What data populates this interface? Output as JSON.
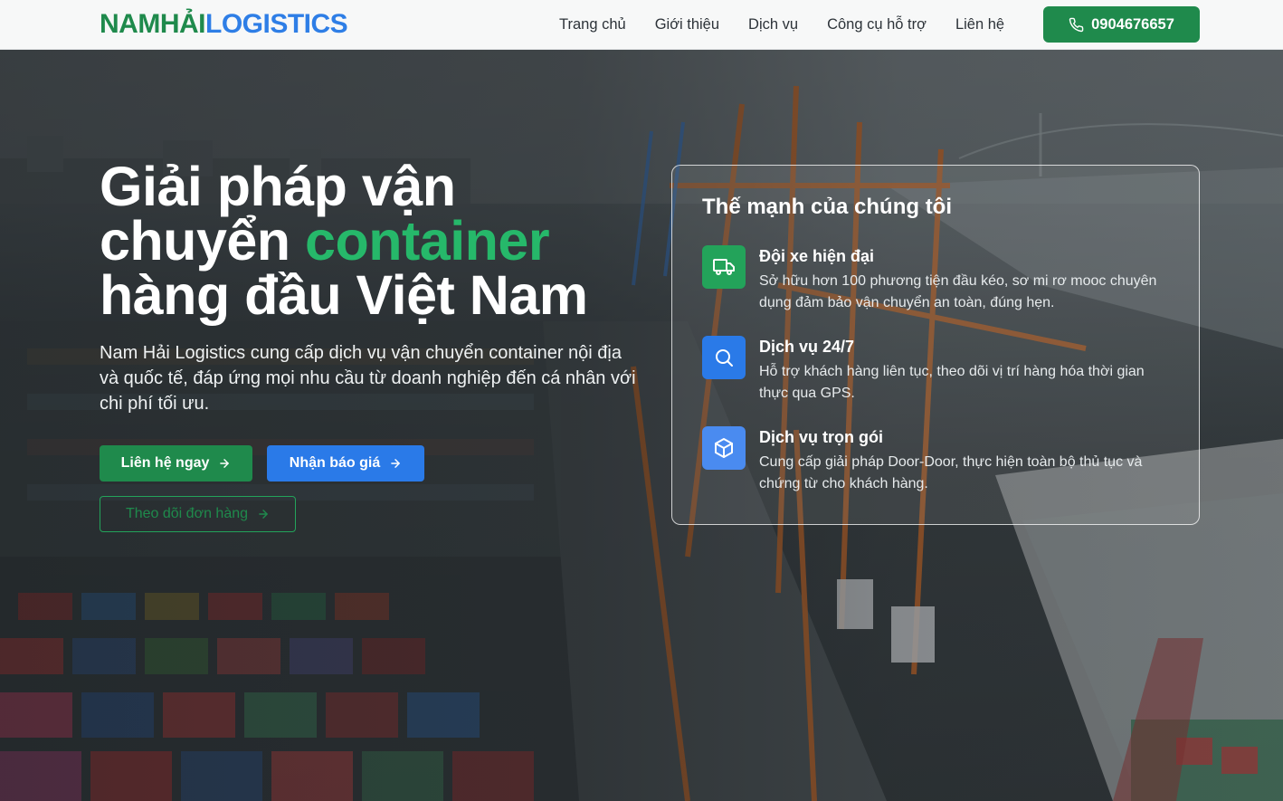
{
  "brand": {
    "logo_part_a": "NAMHẢI",
    "logo_part_b": "LOGISTICS"
  },
  "nav": {
    "items": [
      {
        "label": "Trang chủ"
      },
      {
        "label": "Giới thiệu"
      },
      {
        "label": "Dịch vụ"
      },
      {
        "label": "Công cụ hỗ trợ"
      },
      {
        "label": "Liên hệ"
      }
    ],
    "phone": "0904676657",
    "phone_icon": "phone-icon"
  },
  "hero": {
    "headline_line1": "Giải pháp vận",
    "headline_line2_prefix": "chuyển ",
    "headline_accent": "container",
    "headline_line3": "hàng đầu Việt Nam",
    "lead": "Nam Hải Logistics cung cấp dịch vụ vận chuyển container nội địa và quốc tế, đáp ứng mọi nhu cầu từ doanh nghiệp đến cá nhân với chi phí tối ưu.",
    "buttons": {
      "contact": "Liên hệ ngay",
      "quote": "Nhận báo giá",
      "track": "Theo dõi đơn hàng"
    }
  },
  "features": {
    "title": "Thế mạnh của chúng tôi",
    "items": [
      {
        "title": "Đội xe hiện đại",
        "desc": "Sở hữu hơn 100 phương tiện đầu kéo, sơ mi rơ mooc chuyên dụng đảm bảo vận chuyển an toàn, đúng hẹn.",
        "icon": "truck-icon"
      },
      {
        "title": "Dịch vụ 24/7",
        "desc": "Hỗ trợ khách hàng liên tục, theo dõi vị trí hàng hóa thời gian thực qua GPS.",
        "icon": "search-icon"
      },
      {
        "title": "Dịch vụ trọn gói",
        "desc": "Cung cấp giải pháp Door-Door, thực hiện toàn bộ thủ tục và chứng từ cho khách hàng.",
        "icon": "package-icon"
      }
    ]
  },
  "colors": {
    "brand_green": "#1f8a4c",
    "brand_blue": "#2e7ee6",
    "accent_green": "#26b86a"
  }
}
